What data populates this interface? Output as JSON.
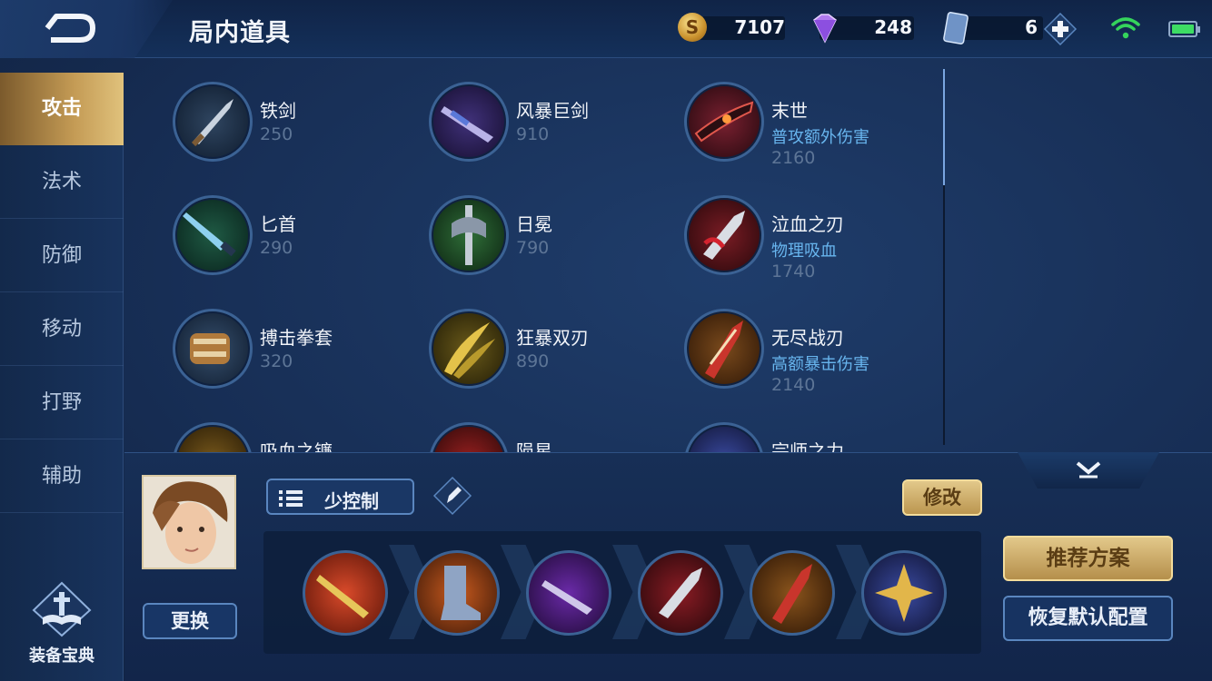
{
  "header": {
    "title": "局内道具",
    "gold": "7107",
    "diamonds": "248",
    "tickets": "6"
  },
  "sidebar": {
    "tabs": [
      {
        "label": "攻击"
      },
      {
        "label": "法术"
      },
      {
        "label": "防御"
      },
      {
        "label": "移动"
      },
      {
        "label": "打野"
      },
      {
        "label": "辅助"
      }
    ],
    "active_tab": "攻击",
    "codex_label": "装备宝典"
  },
  "items": [
    {
      "name": "铁剑",
      "desc": "",
      "price": "250",
      "icon": "sword-icon"
    },
    {
      "name": "风暴巨剑",
      "desc": "",
      "price": "910",
      "icon": "greatsword-icon"
    },
    {
      "name": "末世",
      "desc": "普攻额外伤害",
      "price": "2160",
      "icon": "doom-blade-icon"
    },
    {
      "name": "匕首",
      "desc": "",
      "price": "290",
      "icon": "dagger-icon"
    },
    {
      "name": "日冕",
      "desc": "",
      "price": "790",
      "icon": "corona-icon"
    },
    {
      "name": "泣血之刃",
      "desc": "物理吸血",
      "price": "1740",
      "icon": "bloodblade-icon"
    },
    {
      "name": "搏击拳套",
      "desc": "",
      "price": "320",
      "icon": "gauntlet-icon"
    },
    {
      "name": "狂暴双刃",
      "desc": "",
      "price": "890",
      "icon": "twin-blades-icon"
    },
    {
      "name": "无尽战刃",
      "desc": "高额暴击伤害",
      "price": "2140",
      "icon": "infinity-blade-icon"
    },
    {
      "name": "吸血之镰",
      "desc": "",
      "price": "",
      "icon": "scythe-icon"
    },
    {
      "name": "陨星",
      "desc": "",
      "price": "",
      "icon": "meteor-icon"
    },
    {
      "name": "宗师之力",
      "desc": "",
      "price": "",
      "icon": "master-power-icon"
    }
  ],
  "build": {
    "plan_name": "少控制",
    "modify_label": "修改",
    "change_label": "更换",
    "recommend_label": "推荐方案",
    "restore_label": "恢复默认配置",
    "slots": [
      "blade-icon",
      "boots-icon",
      "axe-icon",
      "bloodblade-icon",
      "infinity-blade-icon",
      "master-power-icon"
    ]
  },
  "colors": {
    "accent_gold": "#d2b06b",
    "desc_blue": "#68b5ee",
    "price_gray": "#5d7596"
  }
}
